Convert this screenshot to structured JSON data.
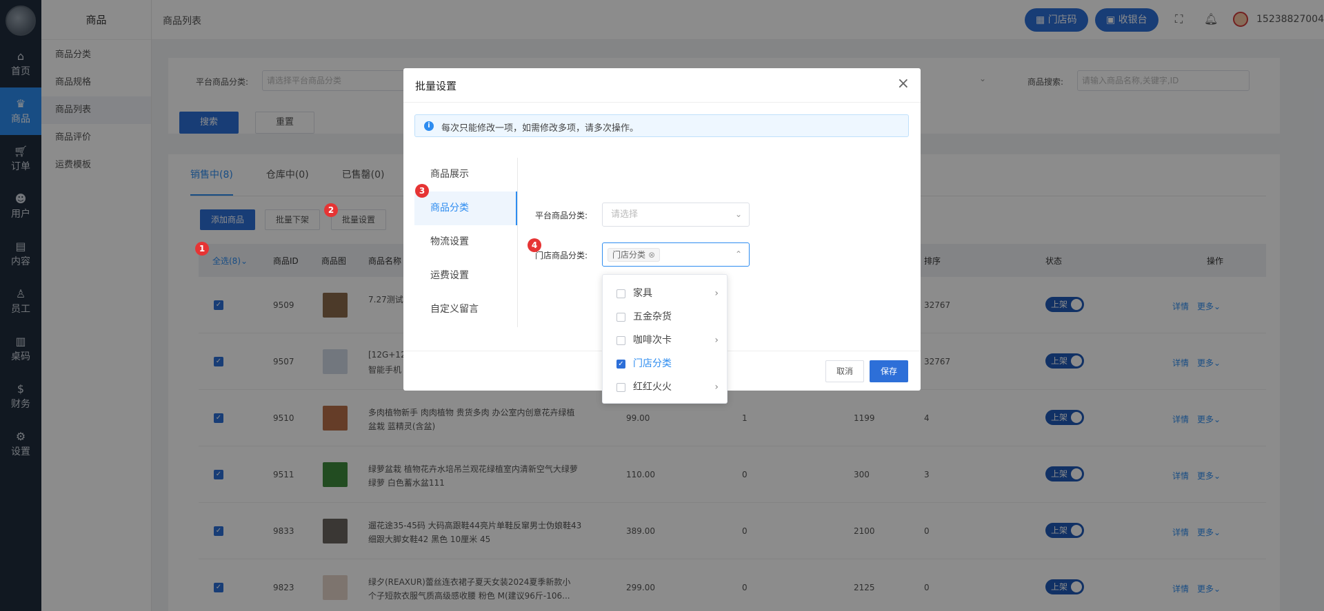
{
  "nav": {
    "items": [
      {
        "icon": "home-icon",
        "label": "首页"
      },
      {
        "icon": "goods-icon",
        "label": "商品"
      },
      {
        "icon": "cart-icon",
        "label": "订单"
      },
      {
        "icon": "users-icon",
        "label": "用户"
      },
      {
        "icon": "content-icon",
        "label": "内容"
      },
      {
        "icon": "staff-icon",
        "label": "员工"
      },
      {
        "icon": "table-code-icon",
        "label": "桌码"
      },
      {
        "icon": "dollar-icon",
        "label": "财务"
      },
      {
        "icon": "gear-icon",
        "label": "设置"
      }
    ],
    "active_index": 1
  },
  "submenu": {
    "title": "商品",
    "items": [
      "商品分类",
      "商品规格",
      "商品列表",
      "商品评价",
      "运费模板"
    ],
    "active_index": 2
  },
  "header": {
    "breadcrumb": "商品列表",
    "store_code_label": "门店码",
    "cashier_label": "收银台",
    "username": "15238827004"
  },
  "filter": {
    "platform_category_label": "平台商品分类:",
    "platform_category_placeholder": "请选择平台商品分类",
    "search_label": "商品搜索:",
    "search_placeholder": "请输入商品名称,关键字,ID",
    "search_button": "搜索",
    "reset_button": "重置"
  },
  "tabs": [
    "销售中(8)",
    "仓库中(0)",
    "已售罄(0)"
  ],
  "actions": {
    "add": "添加商品",
    "batch_off": "批量下架",
    "batch_set": "批量设置"
  },
  "table": {
    "headers": {
      "select_all": "全选(8)",
      "id": "商品ID",
      "image": "商品图",
      "name": "商品名称",
      "sort": "排序",
      "status": "状态",
      "ops": "操作"
    },
    "rows": [
      {
        "id": "9509",
        "name": "7.27测试",
        "name2": "",
        "price": "",
        "sales": "",
        "stock": "",
        "sort": "32767",
        "status": "上架",
        "color": "#8a6a4c"
      },
      {
        "id": "9507",
        "name": "[12G+12",
        "name2": "智能手机",
        "price": "",
        "sales": "",
        "stock": "",
        "sort": "32767",
        "status": "上架",
        "color": "#cfd9e6"
      },
      {
        "id": "9510",
        "name": "多肉植物新手 肉肉植物 贵货多肉 办公室内创意花卉绿植",
        "name2": "盆栽 蓝精灵(含盆)",
        "price": "99.00",
        "sales": "1",
        "stock": "1199",
        "sort": "4",
        "status": "上架",
        "color": "#b9704a"
      },
      {
        "id": "9511",
        "name": "绿萝盆栽 植物花卉水培吊兰观花绿植室内清新空气大绿萝",
        "name2": "绿萝 白色蓄水盆111",
        "price": "110.00",
        "sales": "0",
        "stock": "300",
        "sort": "3",
        "status": "上架",
        "color": "#3f8a3c"
      },
      {
        "id": "9833",
        "name": "遛花途35-45码 大码高跟鞋44亮片单鞋反窜男士伪娘鞋43",
        "name2": "细跟大脚女鞋42 黑色 10厘米 45",
        "price": "389.00",
        "sales": "0",
        "stock": "2100",
        "sort": "0",
        "status": "上架",
        "color": "#6b6460"
      },
      {
        "id": "9823",
        "name": "绿夕(REAXUR)蕾丝连衣裙子夏天女装2024夏季新款小",
        "name2": "个子短款衣服气质高级感收腰 粉色 M(建议96斤-106...",
        "price": "299.00",
        "sales": "0",
        "stock": "2125",
        "sort": "0",
        "status": "上架",
        "color": "#e3d3c8"
      }
    ],
    "detail_link": "详情",
    "more_link": "更多"
  },
  "modal": {
    "title": "批量设置",
    "notice": "每次只能修改一项，如需修改多项，请多次操作。",
    "tabs": [
      "商品展示",
      "商品分类",
      "物流设置",
      "运费设置",
      "自定义留言"
    ],
    "active_tab": 1,
    "platform_category_label": "平台商品分类:",
    "platform_category_placeholder": "请选择",
    "store_category_label": "门店商品分类:",
    "store_category_chip": "门店分类",
    "cancel": "取消",
    "save": "保存"
  },
  "dropdown": {
    "options": [
      {
        "label": "家具",
        "checked": false,
        "has_children": true
      },
      {
        "label": "五金杂货",
        "checked": false,
        "has_children": false
      },
      {
        "label": "咖啡次卡",
        "checked": false,
        "has_children": true
      },
      {
        "label": "门店分类",
        "checked": true,
        "has_children": false
      },
      {
        "label": "红红火火",
        "checked": false,
        "has_children": true
      }
    ]
  },
  "badges": [
    "1",
    "2",
    "3",
    "4"
  ]
}
